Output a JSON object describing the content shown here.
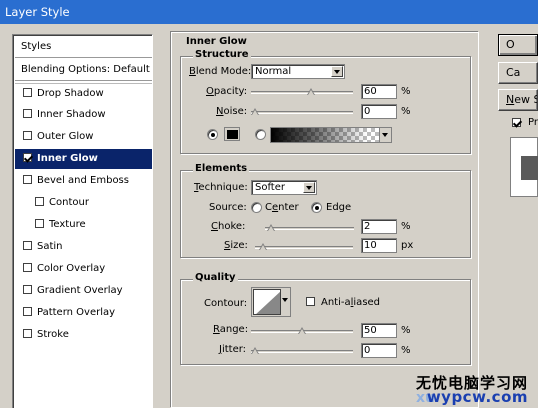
{
  "window": {
    "title": "Layer Style"
  },
  "style_list": {
    "header": "Styles",
    "blending": "Blending Options: Default",
    "items": [
      {
        "label": "Drop Shadow",
        "checked": false,
        "sub": false,
        "selected": false
      },
      {
        "label": "Inner Shadow",
        "checked": false,
        "sub": false,
        "selected": false
      },
      {
        "label": "Outer Glow",
        "checked": false,
        "sub": false,
        "selected": false
      },
      {
        "label": "Inner Glow",
        "checked": true,
        "sub": false,
        "selected": true
      },
      {
        "label": "Bevel and Emboss",
        "checked": false,
        "sub": false,
        "selected": false
      },
      {
        "label": "Contour",
        "checked": false,
        "sub": true,
        "selected": false
      },
      {
        "label": "Texture",
        "checked": false,
        "sub": true,
        "selected": false
      },
      {
        "label": "Satin",
        "checked": false,
        "sub": false,
        "selected": false
      },
      {
        "label": "Color Overlay",
        "checked": false,
        "sub": false,
        "selected": false
      },
      {
        "label": "Gradient Overlay",
        "checked": false,
        "sub": false,
        "selected": false
      },
      {
        "label": "Pattern Overlay",
        "checked": false,
        "sub": false,
        "selected": false
      },
      {
        "label": "Stroke",
        "checked": false,
        "sub": false,
        "selected": false
      }
    ]
  },
  "panel": {
    "title": "Inner Glow"
  },
  "structure": {
    "title": "Structure",
    "blend_mode_label": "Blend Mode:",
    "blend_mode_value": "Normal",
    "opacity_label": "Opacity:",
    "opacity_value": "60",
    "opacity_unit": "%",
    "opacity_fraction": 0.6,
    "noise_label": "Noise:",
    "noise_value": "0",
    "noise_unit": "%",
    "noise_fraction": 0.0,
    "glow_color": "#000000"
  },
  "elements": {
    "title": "Elements",
    "technique_label": "Technique:",
    "technique_value": "Softer",
    "source_label": "Source:",
    "source_center": "Center",
    "source_edge": "Edge",
    "choke_label": "Choke:",
    "choke_value": "2",
    "choke_unit": "%",
    "choke_fraction": 0.02,
    "size_label": "Size:",
    "size_value": "10",
    "size_unit": "px",
    "size_fraction": 0.04
  },
  "quality": {
    "title": "Quality",
    "contour_label": "Contour:",
    "anti_aliased_label": "Anti-aliased",
    "range_label": "Range:",
    "range_value": "50",
    "range_unit": "%",
    "range_fraction": 0.5,
    "jitter_label": "Jitter:",
    "jitter_value": "0",
    "jitter_unit": "%",
    "jitter_fraction": 0.0
  },
  "buttons": {
    "ok": "O",
    "cancel": "Ca",
    "new_style": "New S",
    "preview_label": "Pr"
  },
  "watermark": {
    "line1": "无忧电脑学习网",
    "line2": "wypcw.com",
    "ghost": "xu"
  }
}
